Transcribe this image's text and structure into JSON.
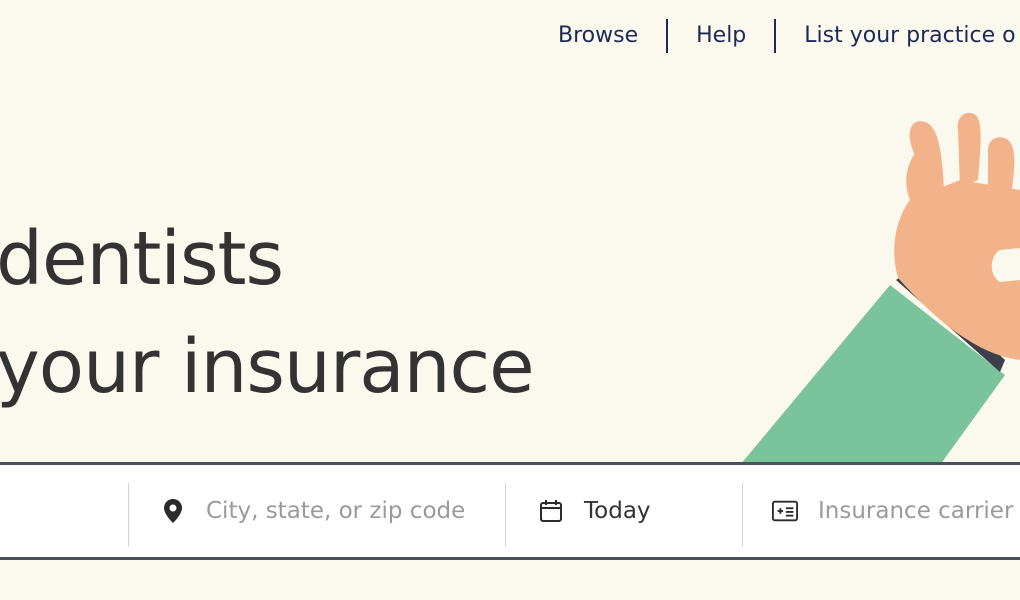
{
  "nav": {
    "browse": "Browse",
    "help": "Help",
    "list_practice": "List your practice o"
  },
  "hero": {
    "line1": "dentists",
    "line2": "your insurance"
  },
  "search": {
    "location_placeholder": "City, state, or zip code",
    "date_value": "Today",
    "insurance_placeholder": "Insurance carrier a"
  },
  "icons": {
    "location": "map-pin-icon",
    "date": "calendar-icon",
    "insurance": "insurance-card-icon"
  },
  "colors": {
    "background": "#FBF8EE",
    "nav_text": "#1C2A55",
    "hand": "#F2B38A",
    "sleeve": "#7BC49B",
    "border": "#4A5060"
  }
}
